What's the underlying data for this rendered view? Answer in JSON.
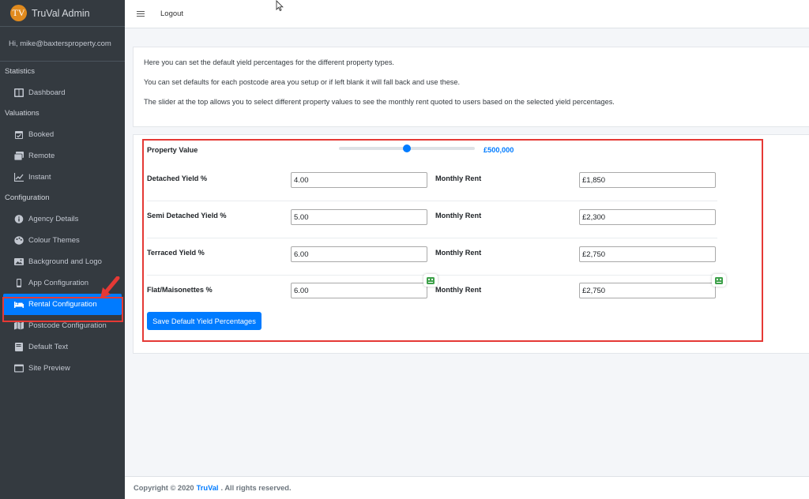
{
  "app": {
    "logo_text": "TV",
    "title": "TruVal Admin"
  },
  "user": {
    "greeting": "Hi, mike@baxtersproperty.com"
  },
  "sidebar": {
    "sections": [
      {
        "header": "Statistics",
        "items": [
          {
            "label": "Dashboard",
            "icon": "dashboard-icon"
          }
        ]
      },
      {
        "header": "Valuations",
        "items": [
          {
            "label": "Booked",
            "icon": "calendar-check-icon"
          },
          {
            "label": "Remote",
            "icon": "images-icon"
          },
          {
            "label": "Instant",
            "icon": "chart-line-icon"
          }
        ]
      },
      {
        "header": "Configuration",
        "items": [
          {
            "label": "Agency Details",
            "icon": "info-circle-icon"
          },
          {
            "label": "Colour Themes",
            "icon": "palette-icon"
          },
          {
            "label": "Background and Logo",
            "icon": "image-icon"
          },
          {
            "label": "App Configuration",
            "icon": "mobile-icon"
          },
          {
            "label": "Rental Configuration",
            "icon": "bed-icon",
            "active": true
          },
          {
            "label": "Postcode Configuration",
            "icon": "map-icon"
          },
          {
            "label": "Default Text",
            "icon": "book-icon"
          },
          {
            "label": "Site Preview",
            "icon": "window-icon"
          }
        ]
      }
    ]
  },
  "topbar": {
    "logout_label": "Logout"
  },
  "info": {
    "line1": "Here you can set the default yield percentages for the different property types.",
    "line2": "You can set defaults for each postcode area you setup or if left blank it will fall back and use these.",
    "line3": "The slider at the top allows you to select different property values to see the monthly rent quoted to users based on the selected yield percentages."
  },
  "form": {
    "property_value_label": "Property Value",
    "property_value_display": "£500,000",
    "slider_fraction": 0.5,
    "rent_label": "Monthly Rent",
    "rows": [
      {
        "label": "Detached Yield %",
        "yield": "4.00",
        "rent": "£1,850"
      },
      {
        "label": "Semi Detached Yield %",
        "yield": "5.00",
        "rent": "£2,300"
      },
      {
        "label": "Terraced Yield %",
        "yield": "6.00",
        "rent": "£2,750"
      },
      {
        "label": "Flat/Maisonettes %",
        "yield": "6.00",
        "rent": "£2,750"
      }
    ],
    "save_label": "Save Default Yield Percentages"
  },
  "footer": {
    "prefix": "Copyright © 2020",
    "brand": "TruVal",
    "suffix": ". All rights reserved."
  },
  "colors": {
    "accent": "#007bff",
    "sidebar_bg": "#343a40",
    "highlight": "#e53935",
    "logo": "#e08a1e"
  }
}
